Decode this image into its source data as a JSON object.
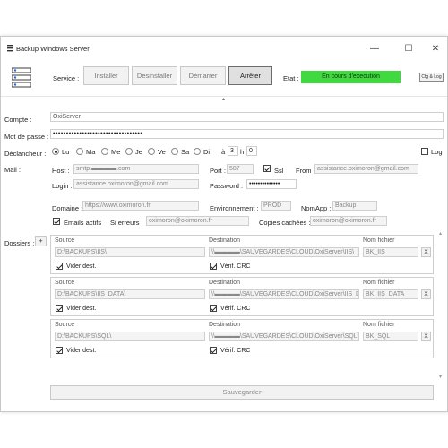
{
  "window": {
    "title": "Backup Windows Server",
    "controls": {
      "minimize": "—",
      "maximize": "☐",
      "close": "✕"
    }
  },
  "service": {
    "label": "Service :",
    "install": "Installer",
    "uninstall": "Desinstaller",
    "start": "Démarrer",
    "stop": "Arrêter",
    "state_label": "Etat :",
    "state_value": "En cours d'execution",
    "cfg_log": "Cfg & Log",
    "state_color": "#40d940"
  },
  "compte": {
    "label": "Compte :",
    "value": "OxiServer"
  },
  "password": {
    "label": "Mot de passe :",
    "value": "••••••••••••••••••••••••••••••••••"
  },
  "trigger": {
    "label": "Déclancheur :",
    "days": [
      {
        "label": "Lu",
        "checked": true
      },
      {
        "label": "Ma",
        "checked": false
      },
      {
        "label": "Me",
        "checked": false
      },
      {
        "label": "Je",
        "checked": false
      },
      {
        "label": "Ve",
        "checked": false
      },
      {
        "label": "Sa",
        "checked": false
      },
      {
        "label": "Di",
        "checked": false
      }
    ],
    "at_label": "à",
    "hour": "3",
    "h_label": "h",
    "minute": "0",
    "log_label": "Log"
  },
  "mail": {
    "label": "Mail :",
    "host_label": "Host :",
    "host_value": "smtp.▬▬▬▬.com",
    "port_label": "Port :",
    "port_value": "587",
    "ssl_label": "Ssl",
    "from_label": "From :",
    "from_value": "assistance.oximoron@gmail.com",
    "login_label": "Login :",
    "login_value": "assistance.oximoron@gmail.com",
    "password_label": "Password :",
    "password_value": "••••••••••••••",
    "domain_label": "Domaine :",
    "domain_value": "https://www.oximoron.fr",
    "env_label": "Environnement :",
    "env_value": "PROD",
    "app_label": "NomApp :",
    "app_value": "Backup",
    "active_label": "Emails actifs",
    "errors_label": "Si erreurs :",
    "errors_value": "oximoron@oximoron.fr",
    "cc_label": "Copies cachées :",
    "cc_value": "oximoron@oximoron.fr"
  },
  "folders": {
    "label": "Dossiers :",
    "add": "+",
    "source_label": "Source",
    "dest_label": "Destination",
    "file_label": "Nom fichier",
    "clear_label": "Vider dest.",
    "crc_label": "Vérif. CRC",
    "remove": "X",
    "items": [
      {
        "source": "D:\\BACKUPS\\IIS\\",
        "destination": "\\\\▬▬▬▬\\SAUVEGARDES\\CLOUD\\OxiServer\\IIS\\",
        "file": "BK_IIS"
      },
      {
        "source": "D:\\BACKUPS\\IIS_DATA\\",
        "destination": "\\\\▬▬▬▬\\SAUVEGARDES\\CLOUD\\OxiServer\\IIS_DATA\\",
        "file": "BK_IIS_DATA"
      },
      {
        "source": "D:\\BACKUPS\\SQL\\",
        "destination": "\\\\▬▬▬▬\\SAUVEGARDES\\CLOUD\\OxiServer\\SQL\\",
        "file": "BK_SQL"
      }
    ]
  },
  "save": "Sauvegarder"
}
